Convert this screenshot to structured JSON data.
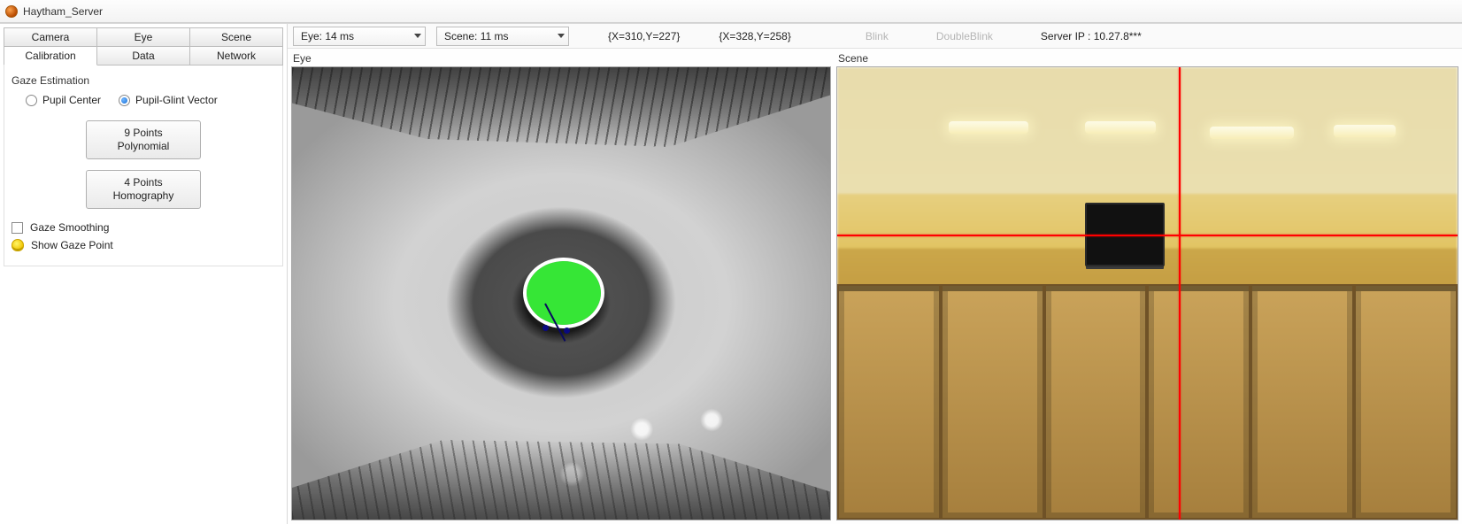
{
  "app": {
    "title": "Haytham_Server"
  },
  "tabs_row1": [
    {
      "label": "Camera"
    },
    {
      "label": "Eye"
    },
    {
      "label": "Scene"
    }
  ],
  "tabs_row2": [
    {
      "label": "Calibration",
      "active": true
    },
    {
      "label": "Data"
    },
    {
      "label": "Network"
    }
  ],
  "calibration": {
    "group_label": "Gaze Estimation",
    "radio_pupil_center": "Pupil Center",
    "radio_pupil_glint": "Pupil-Glint Vector",
    "radio_selected": "pupil_glint",
    "btn_9pts": "9 Points\nPolynomial",
    "btn_4pts": "4 Points\nHomography",
    "chk_smoothing": "Gaze Smoothing",
    "chk_smoothing_checked": false,
    "show_gaze_point": "Show Gaze Point"
  },
  "toolbar": {
    "eye_combo": "Eye: 14 ms",
    "scene_combo": "Scene: 11 ms",
    "coord1": "{X=310,Y=227}",
    "coord2": "{X=328,Y=258}",
    "blink": "Blink",
    "double_blink": "DoubleBlink",
    "server_ip_label": "Server IP : 10.27.8***"
  },
  "views": {
    "eye_label": "Eye",
    "scene_label": "Scene",
    "scene_cross": {
      "h_pct": 37,
      "v_pct": 55
    }
  }
}
